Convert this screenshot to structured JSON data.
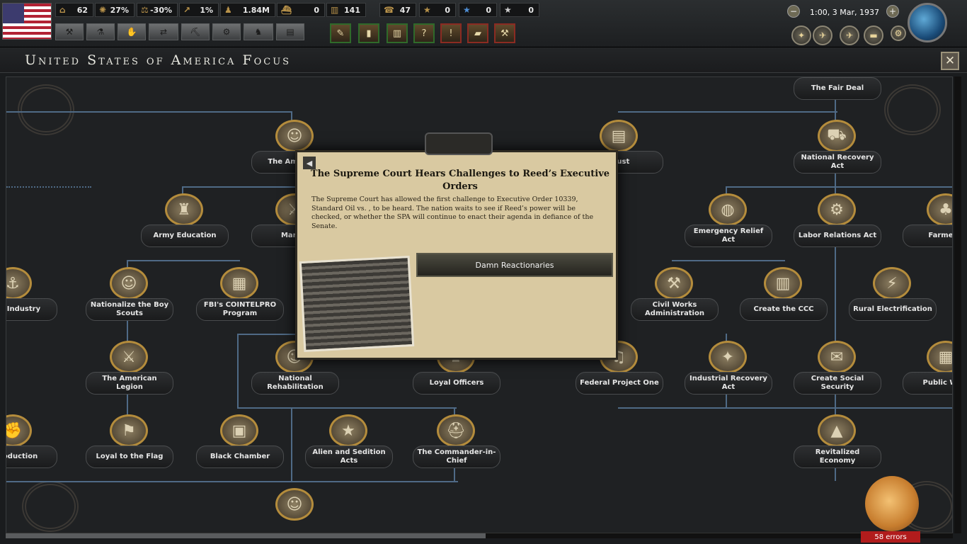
{
  "topbar": {
    "resources": [
      {
        "icon": "political-power-icon",
        "value": "62"
      },
      {
        "icon": "stability-icon",
        "value": "27%"
      },
      {
        "icon": "war-support-icon",
        "value": "-30%"
      },
      {
        "icon": "command-power-icon",
        "value": "1%"
      },
      {
        "icon": "manpower-icon",
        "value": "1.84M"
      },
      {
        "icon": "convoys-icon",
        "value": "0"
      },
      {
        "icon": "factories-icon",
        "value": "141"
      },
      {
        "icon": "fuel-icon",
        "value": "47"
      },
      {
        "icon": "army-xp-icon",
        "value": "0"
      },
      {
        "icon": "navy-xp-icon",
        "value": "0"
      },
      {
        "icon": "air-xp-icon",
        "value": "0"
      }
    ],
    "date": "1:00, 3 Mar, 1937"
  },
  "panel": {
    "title": "United States of America Focus"
  },
  "event": {
    "title": "The Supreme Court Hears Challenges to Reed’s Executive Orders",
    "body": "The Supreme Court has allowed the first challenge to Executive Order 10339, Standard Oil vs. , to be heard. The nation waits to see if Reed’s power will be checked, or whether the SPA will continue to enact their agenda in defiance of the Senate.",
    "option": "Damn Reactionaries"
  },
  "focuses": [
    {
      "label": "The American"
    },
    {
      "label": "Army Education"
    },
    {
      "label": "Martial"
    },
    {
      "label": "time Industry"
    },
    {
      "label": "Nationalize the Boy Scouts"
    },
    {
      "label": "FBI's COINTELPRO Program"
    },
    {
      "label": "The American Legion"
    },
    {
      "label": "National Rehabilitation"
    },
    {
      "label": "Loyal Officers"
    },
    {
      "label": "l Production"
    },
    {
      "label": "Loyal to the Flag"
    },
    {
      "label": "Black Chamber"
    },
    {
      "label": "Alien and Sedition Acts"
    },
    {
      "label": "The Commander-in-Chief"
    },
    {
      "label": "Trust"
    },
    {
      "label": "The Fair Deal"
    },
    {
      "label": "National Recovery Act"
    },
    {
      "label": "Emergency Relief Act"
    },
    {
      "label": "Labor Relations Act"
    },
    {
      "label": "Farmer R"
    },
    {
      "label": "Civil Works Administration"
    },
    {
      "label": "Create the CCC"
    },
    {
      "label": "Rural Electrification"
    },
    {
      "label": "Federal Project One"
    },
    {
      "label": "Industrial Recovery Act"
    },
    {
      "label": "Create Social Security"
    },
    {
      "label": "Public Work"
    },
    {
      "label": "Revitalized Economy"
    }
  ],
  "status": {
    "errors": "58 errors"
  }
}
